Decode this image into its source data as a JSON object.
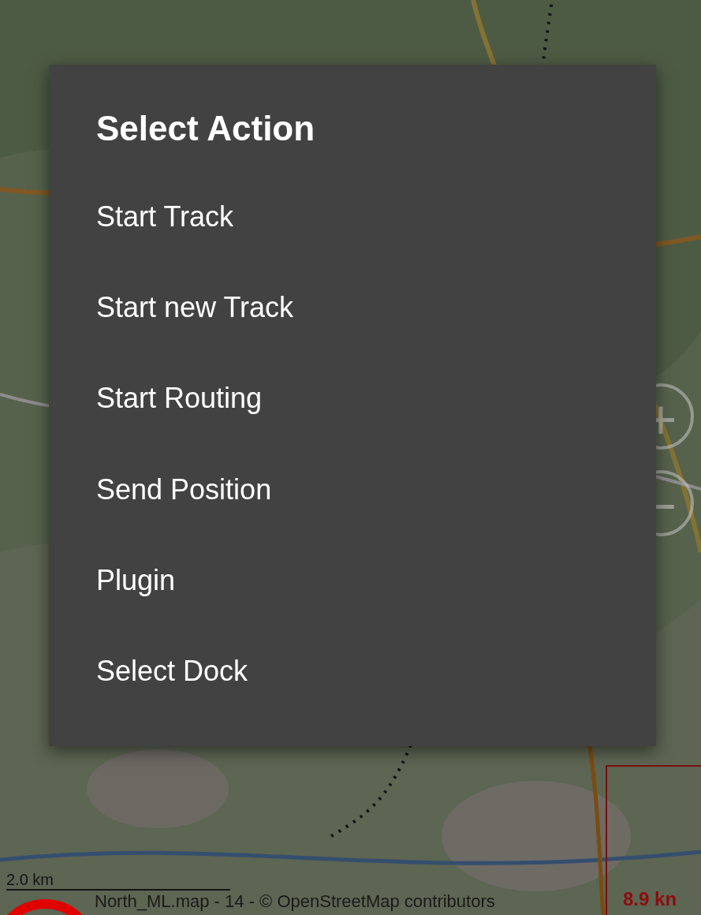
{
  "zoom_controls": [
    {
      "label": "+"
    },
    {
      "label": "−"
    }
  ],
  "scale_bar": {
    "label": "2.0 km"
  },
  "attribution": "North_ML.map - 14 - © OpenStreetMap contributors",
  "speed": "8.9 kn",
  "dialog": {
    "title": "Select Action",
    "items": [
      {
        "label": "Start Track"
      },
      {
        "label": "Start new Track"
      },
      {
        "label": "Start Routing"
      },
      {
        "label": "Send Position"
      },
      {
        "label": "Plugin"
      },
      {
        "label": "Select Dock"
      }
    ]
  }
}
